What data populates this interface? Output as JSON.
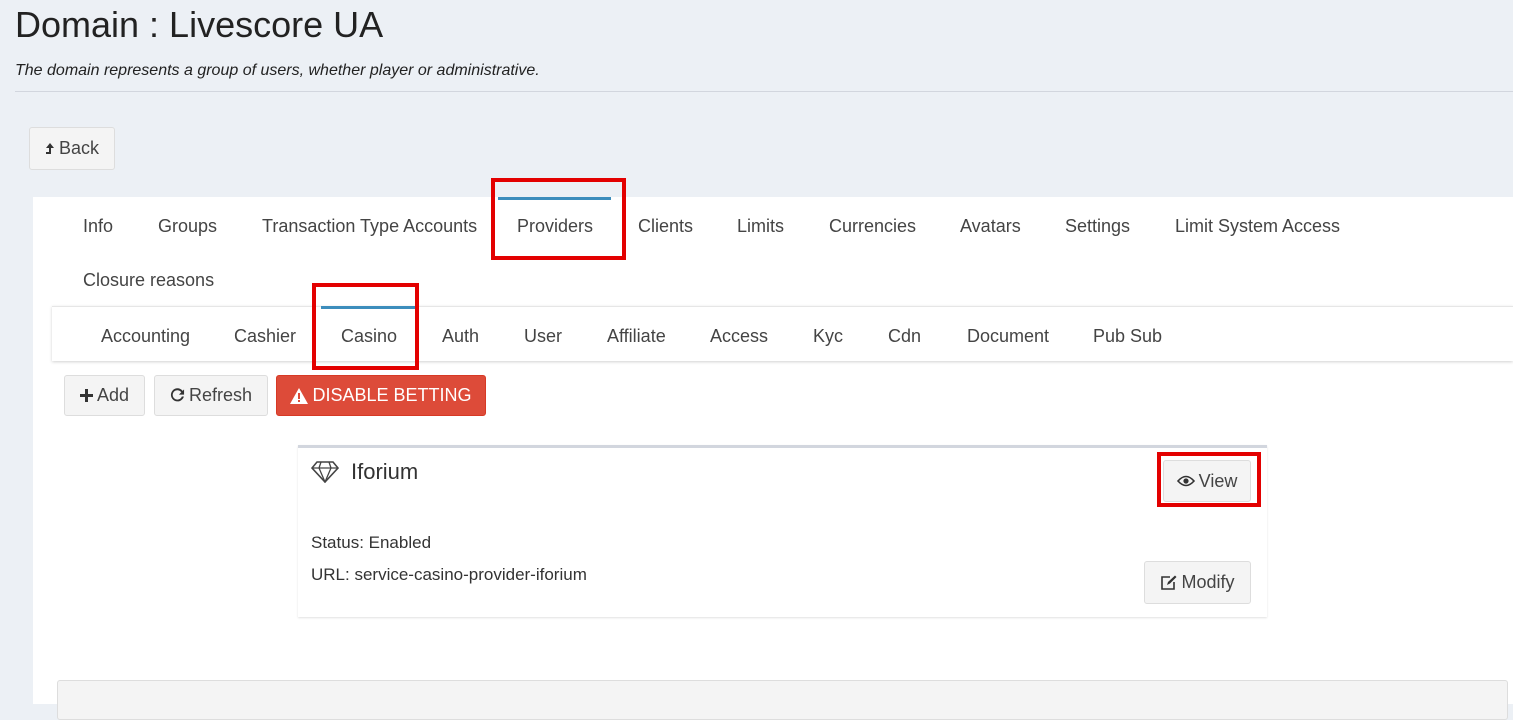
{
  "header": {
    "title": "Domain : Livescore UA",
    "subtitle": "The domain represents a group of users, whether player or administrative."
  },
  "back_button": {
    "label": "Back",
    "icon": "arrow-up-icon"
  },
  "main_tabs": [
    {
      "label": "Info"
    },
    {
      "label": "Groups"
    },
    {
      "label": "Transaction Type Accounts"
    },
    {
      "label": "Providers",
      "active": true
    },
    {
      "label": "Clients"
    },
    {
      "label": "Limits"
    },
    {
      "label": "Currencies"
    },
    {
      "label": "Avatars"
    },
    {
      "label": "Settings"
    },
    {
      "label": "Limit System Access"
    },
    {
      "label": "Closure reasons"
    }
  ],
  "sub_tabs": [
    {
      "label": "Accounting"
    },
    {
      "label": "Cashier"
    },
    {
      "label": "Casino",
      "active": true
    },
    {
      "label": "Auth"
    },
    {
      "label": "User"
    },
    {
      "label": "Affiliate"
    },
    {
      "label": "Access"
    },
    {
      "label": "Kyc"
    },
    {
      "label": "Cdn"
    },
    {
      "label": "Document"
    },
    {
      "label": "Pub Sub"
    }
  ],
  "toolbar": {
    "add_label": "Add",
    "refresh_label": "Refresh",
    "disable_label": "DISABLE BETTING"
  },
  "provider": {
    "name": "Iforium",
    "icon": "diamond-icon",
    "status": "Status: Enabled",
    "url": "URL: service-casino-provider-iforium",
    "view_label": "View",
    "modify_label": "Modify"
  },
  "colors": {
    "accent": "#3c8dbc",
    "danger": "#dd4b39",
    "highlight": "#e30000"
  }
}
